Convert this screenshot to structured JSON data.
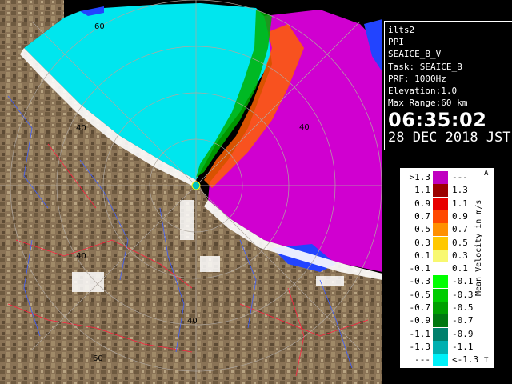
{
  "info": {
    "site": "ilts2",
    "product": "PPI",
    "product_name": "SEAICE_B_V",
    "task": "Task: SEAICE_B",
    "prf": "PRF: 1000Hz",
    "elevation": "Elevation:1.0",
    "max_range": "Max Range:60 km",
    "time": "06:35:02",
    "date": "28 DEC 2018 JST"
  },
  "map": {
    "range_labels": [
      "60",
      "40",
      "40",
      "40",
      "40",
      "60"
    ],
    "colors": {
      "ocean": "#00e6ee",
      "land": "#8a7356",
      "rain_magenta": "#d000d0",
      "sea_ice_blue": "#2244ff",
      "snow_white": "#ffffff",
      "rings": "#b0a8a0",
      "roads": "#ff2040",
      "rivers": "#4060ff"
    }
  },
  "legend": {
    "title": "Mean Velocity in m/s",
    "corner_top": "A",
    "corner_bottom": "T",
    "rows": [
      {
        "left": ">1.3",
        "color": "#c000c0",
        "right": "---"
      },
      {
        "left": "1.1",
        "color": "#9c0000",
        "right": "1.3"
      },
      {
        "left": "0.9",
        "color": "#e80000",
        "right": "1.1"
      },
      {
        "left": "0.7",
        "color": "#ff4800",
        "right": "0.9"
      },
      {
        "left": "0.5",
        "color": "#ff9000",
        "right": "0.7"
      },
      {
        "left": "0.3",
        "color": "#ffc800",
        "right": "0.5"
      },
      {
        "left": "0.1",
        "color": "#f8f870",
        "right": "0.3"
      },
      {
        "left": "-0.1",
        "color": "#ffffff",
        "right": "0.1"
      },
      {
        "left": "-0.3",
        "color": "#00ff00",
        "right": "-0.1"
      },
      {
        "left": "-0.5",
        "color": "#00cc00",
        "right": "-0.3"
      },
      {
        "left": "-0.7",
        "color": "#00a000",
        "right": "-0.5"
      },
      {
        "left": "-0.9",
        "color": "#007810",
        "right": "-0.7"
      },
      {
        "left": "-1.1",
        "color": "#00806c",
        "right": "-0.9"
      },
      {
        "left": "-1.3",
        "color": "#00b0b0",
        "right": "-1.1"
      },
      {
        "left": "---",
        "color": "#00f0f8",
        "right": "<-1.3"
      }
    ]
  }
}
